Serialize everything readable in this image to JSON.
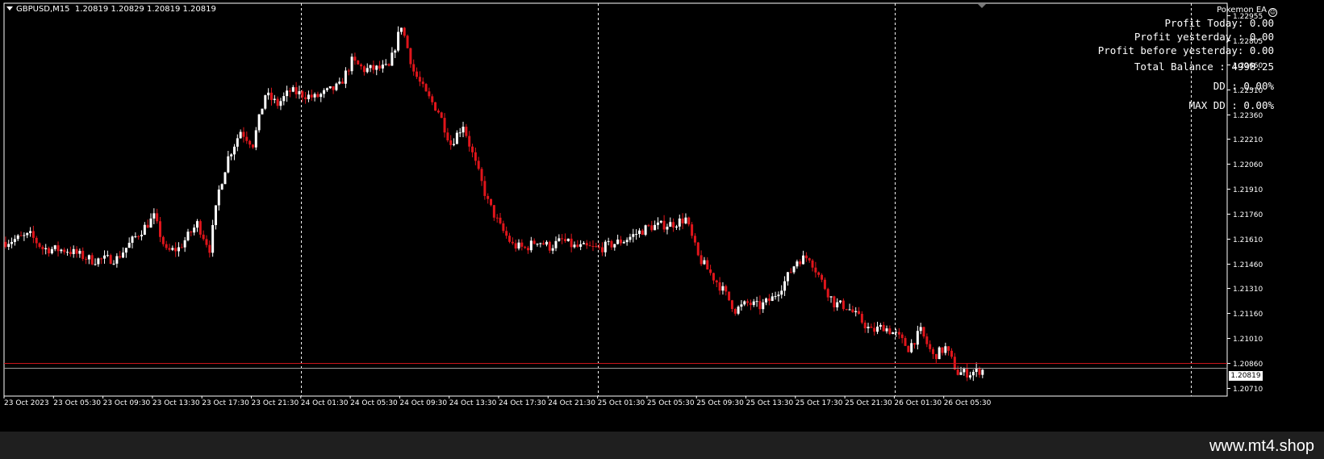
{
  "header": {
    "symbol": "GBPUSD,M15",
    "ohlc": "1.20819 1.20829 1.20819 1.20819"
  },
  "ea": {
    "name": "Pokemon EA",
    "profit_today": "Profit Today: 0.00",
    "profit_yesterday": "Profit yesterday : 0.00",
    "profit_before_yesterday": "Profit before yesterday: 0.00",
    "total_balance": "Total Balance : 4998.25",
    "dd": "DD : 0.00%",
    "max_dd": "MAX DD : 0.00%"
  },
  "current_price_label": "1.20819",
  "watermark": "www.mt4.shop",
  "colors": {
    "background": "#000000",
    "bull": "#ffffff",
    "bear": "#e0151b",
    "grid": "#ffffff",
    "price_line": "#c8141a"
  },
  "chart_data": {
    "type": "candlestick",
    "symbol": "GBPUSD",
    "timeframe": "M15",
    "ylim": [
      1.2066,
      1.2303
    ],
    "y_ticks": [
      "1.22955",
      "1.22805",
      "1.22660",
      "1.22510",
      "1.22360",
      "1.22210",
      "1.22060",
      "1.21910",
      "1.21760",
      "1.21610",
      "1.21460",
      "1.21310",
      "1.21160",
      "1.21010",
      "1.20860",
      "1.20710"
    ],
    "x_ticks": [
      "23 Oct 2023",
      "23 Oct 05:30",
      "23 Oct 09:30",
      "23 Oct 13:30",
      "23 Oct 17:30",
      "23 Oct 21:30",
      "24 Oct 01:30",
      "24 Oct 05:30",
      "24 Oct 09:30",
      "24 Oct 13:30",
      "24 Oct 17:30",
      "24 Oct 21:30",
      "25 Oct 01:30",
      "25 Oct 05:30",
      "25 Oct 09:30",
      "25 Oct 13:30",
      "25 Oct 17:30",
      "25 Oct 21:30",
      "26 Oct 01:30",
      "26 Oct 05:30"
    ],
    "day_separators": [
      "24 Oct 00:00",
      "25 Oct 00:00",
      "26 Oct 00:00",
      "27 Oct 00:00"
    ],
    "current_price": 1.20819,
    "price_line": 1.2086,
    "bid_line": 1.20829,
    "close_path": [
      [
        "23 Oct 00:00",
        1.2159
      ],
      [
        "23 Oct 02:00",
        1.2163
      ],
      [
        "23 Oct 03:00",
        1.2155
      ],
      [
        "23 Oct 05:00",
        1.2154
      ],
      [
        "23 Oct 07:00",
        1.2148
      ],
      [
        "23 Oct 09:00",
        1.2149
      ],
      [
        "23 Oct 10:30",
        1.2162
      ],
      [
        "23 Oct 12:00",
        1.2174
      ],
      [
        "23 Oct 13:00",
        1.2153
      ],
      [
        "23 Oct 14:00",
        1.2155
      ],
      [
        "23 Oct 15:30",
        1.217
      ],
      [
        "23 Oct 16:30",
        1.2155
      ],
      [
        "23 Oct 17:15",
        1.219
      ],
      [
        "23 Oct 18:00",
        1.221
      ],
      [
        "23 Oct 19:00",
        1.2226
      ],
      [
        "23 Oct 20:00",
        1.2218
      ],
      [
        "23 Oct 21:00",
        1.2248
      ],
      [
        "23 Oct 22:00",
        1.2242
      ],
      [
        "23 Oct 23:00",
        1.225
      ],
      [
        "24 Oct 01:00",
        1.2246
      ],
      [
        "24 Oct 03:00",
        1.2253
      ],
      [
        "24 Oct 04:00",
        1.2268
      ],
      [
        "24 Oct 05:00",
        1.2263
      ],
      [
        "24 Oct 07:00",
        1.2264
      ],
      [
        "24 Oct 08:00",
        1.229
      ],
      [
        "24 Oct 09:00",
        1.2262
      ],
      [
        "24 Oct 10:00",
        1.2248
      ],
      [
        "24 Oct 11:00",
        1.2238
      ],
      [
        "24 Oct 12:00",
        1.2218
      ],
      [
        "24 Oct 13:00",
        1.223
      ],
      [
        "24 Oct 14:00",
        1.2206
      ],
      [
        "24 Oct 15:00",
        1.2183
      ],
      [
        "24 Oct 16:00",
        1.2168
      ],
      [
        "24 Oct 17:00",
        1.2157
      ],
      [
        "24 Oct 18:00",
        1.2155
      ],
      [
        "24 Oct 19:00",
        1.216
      ],
      [
        "24 Oct 20:00",
        1.2156
      ],
      [
        "24 Oct 21:00",
        1.216
      ],
      [
        "24 Oct 22:00",
        1.2156
      ],
      [
        "25 Oct 00:00",
        1.2155
      ],
      [
        "25 Oct 02:00",
        1.216
      ],
      [
        "25 Oct 04:00",
        1.2168
      ],
      [
        "25 Oct 06:00",
        1.217
      ],
      [
        "25 Oct 07:00",
        1.2173
      ],
      [
        "25 Oct 08:00",
        1.215
      ],
      [
        "25 Oct 09:00",
        1.214
      ],
      [
        "25 Oct 10:00",
        1.213
      ],
      [
        "25 Oct 11:00",
        1.2118
      ],
      [
        "25 Oct 12:00",
        1.2122
      ],
      [
        "25 Oct 13:00",
        1.212
      ],
      [
        "25 Oct 14:00",
        1.2125
      ],
      [
        "25 Oct 15:00",
        1.2135
      ],
      [
        "25 Oct 16:00",
        1.2148
      ],
      [
        "25 Oct 17:00",
        1.215
      ],
      [
        "25 Oct 18:00",
        1.2135
      ],
      [
        "25 Oct 19:00",
        1.2122
      ],
      [
        "25 Oct 20:00",
        1.212
      ],
      [
        "25 Oct 21:00",
        1.2113
      ],
      [
        "25 Oct 22:00",
        1.2105
      ],
      [
        "25 Oct 23:00",
        1.2108
      ],
      [
        "26 Oct 00:00",
        1.2103
      ],
      [
        "26 Oct 01:00",
        1.2095
      ],
      [
        "26 Oct 02:00",
        1.2105
      ],
      [
        "26 Oct 03:00",
        1.209
      ],
      [
        "26 Oct 04:00",
        1.2095
      ],
      [
        "26 Oct 05:00",
        1.208
      ],
      [
        "26 Oct 06:00",
        1.208
      ],
      [
        "26 Oct 07:00",
        1.2082
      ]
    ],
    "grid": "day separators only",
    "legend": "none"
  }
}
